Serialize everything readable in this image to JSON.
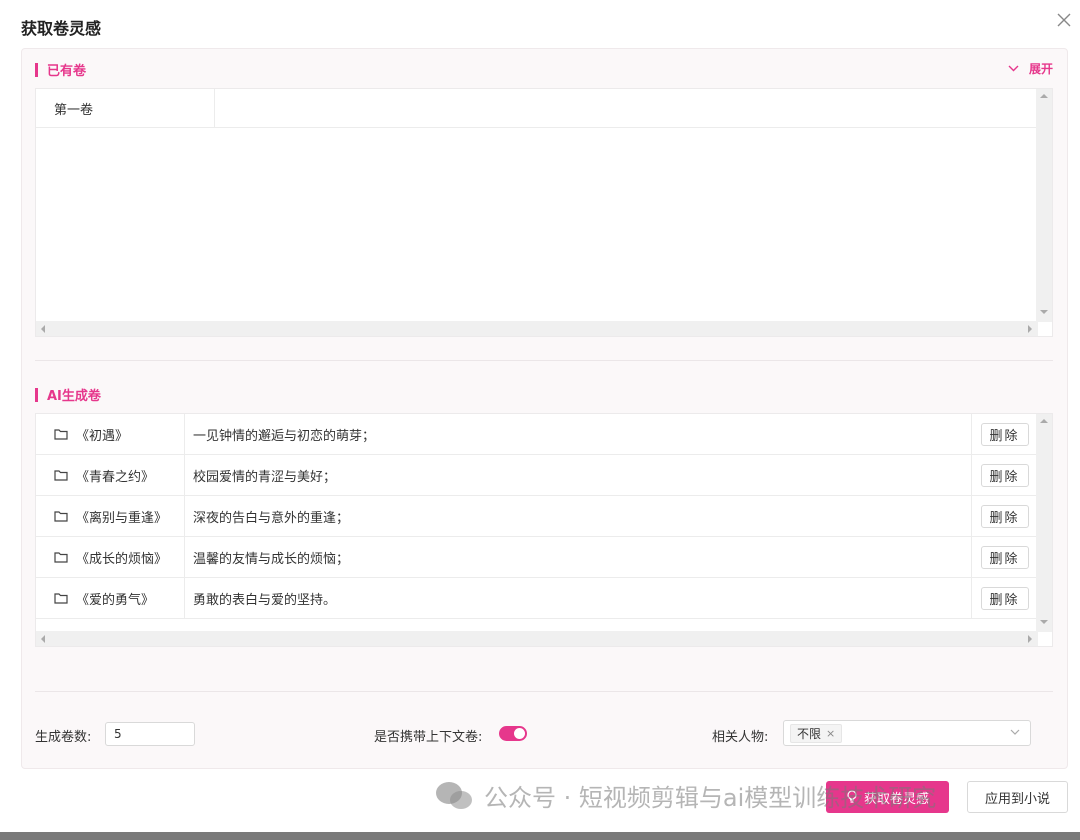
{
  "dialog": {
    "title": "获取卷灵感",
    "close_icon": "close-icon"
  },
  "existing": {
    "section_title": "已有卷",
    "expand_label": "展开",
    "rows": [
      {
        "name": "第一卷"
      }
    ]
  },
  "ai": {
    "section_title": "AI生成卷",
    "rows": [
      {
        "name": "《初遇》",
        "desc": "一见钟情的邂逅与初恋的萌芽；",
        "action": "删除"
      },
      {
        "name": "《青春之约》",
        "desc": "校园爱情的青涩与美好；",
        "action": "删除"
      },
      {
        "name": "《离别与重逢》",
        "desc": "深夜的告白与意外的重逢；",
        "action": "删除"
      },
      {
        "name": "《成长的烦恼》",
        "desc": "温馨的友情与成长的烦恼；",
        "action": "删除"
      },
      {
        "name": "《爱的勇气》",
        "desc": "勇敢的表白与爱的坚持。",
        "action": "删除"
      }
    ]
  },
  "settings": {
    "count_label": "生成卷数:",
    "count_value": "5",
    "context_label": "是否携带上下文卷:",
    "context_enabled": true,
    "characters_label": "相关人物:",
    "characters_tag": "不限",
    "tag_remove": "×"
  },
  "footer": {
    "primary_label": "获取卷灵感",
    "secondary_label": "应用到小说"
  },
  "watermark": {
    "text": "公众号 · 短视频剪辑与ai模型训练技术研究"
  },
  "colors": {
    "accent": "#e6378c",
    "panel_bg": "#fbf8f9"
  }
}
